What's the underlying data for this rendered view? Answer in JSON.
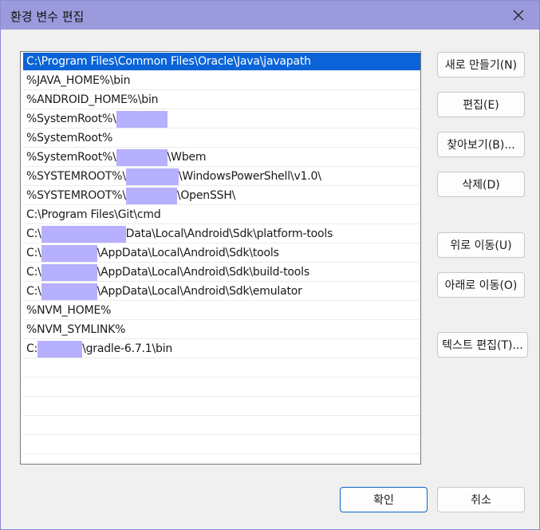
{
  "window": {
    "title": "환경 변수 편집"
  },
  "paths": [
    {
      "pre": "C:\\Program Files\\Common Files\\Oracle\\Java\\javapath",
      "redact": 0,
      "post": "",
      "selected": true
    },
    {
      "pre": "%JAVA_HOME%\\bin",
      "redact": 0,
      "post": ""
    },
    {
      "pre": "%ANDROID_HOME%\\bin",
      "redact": 0,
      "post": ""
    },
    {
      "pre": "%SystemRoot%\\",
      "redact": 64,
      "post": ""
    },
    {
      "pre": "%SystemRoot%",
      "redact": 0,
      "post": ""
    },
    {
      "pre": "%SystemRoot%\\",
      "redact": 64,
      "post": "\\Wbem"
    },
    {
      "pre": "%SYSTEMROOT%\\",
      "redact": 66,
      "post": "\\WindowsPowerShell\\v1.0\\"
    },
    {
      "pre": "%SYSTEMROOT%\\",
      "redact": 64,
      "post": "\\OpenSSH\\"
    },
    {
      "pre": "C:\\Program Files\\Git\\cmd",
      "redact": 0,
      "post": ""
    },
    {
      "pre": "C:\\",
      "redact": 106,
      "post": "Data\\Local\\Android\\Sdk\\platform-tools"
    },
    {
      "pre": "C:\\",
      "redact": 70,
      "post": "\\AppData\\Local\\Android\\Sdk\\tools"
    },
    {
      "pre": "C:\\",
      "redact": 70,
      "post": "\\AppData\\Local\\Android\\Sdk\\build-tools"
    },
    {
      "pre": "C:\\",
      "redact": 70,
      "post": "\\AppData\\Local\\Android\\Sdk\\emulator"
    },
    {
      "pre": "%NVM_HOME%",
      "redact": 0,
      "post": ""
    },
    {
      "pre": "%NVM_SYMLINK%",
      "redact": 0,
      "post": ""
    },
    {
      "pre": "C:",
      "redact": 56,
      "post": "\\gradle-6.7.1\\bin"
    }
  ],
  "buttons": {
    "new": "새로 만들기(N)",
    "edit": "편집(E)",
    "browse": "찾아보기(B)...",
    "delete": "삭제(D)",
    "move_up": "위로 이동(U)",
    "move_down": "아래로 이동(O)",
    "edit_text": "텍스트 편집(T)...",
    "ok": "확인",
    "cancel": "취소"
  },
  "colors": {
    "titlebar": "#9a9adc",
    "selection": "#0a64d8",
    "redaction": "#b6b0ff"
  }
}
